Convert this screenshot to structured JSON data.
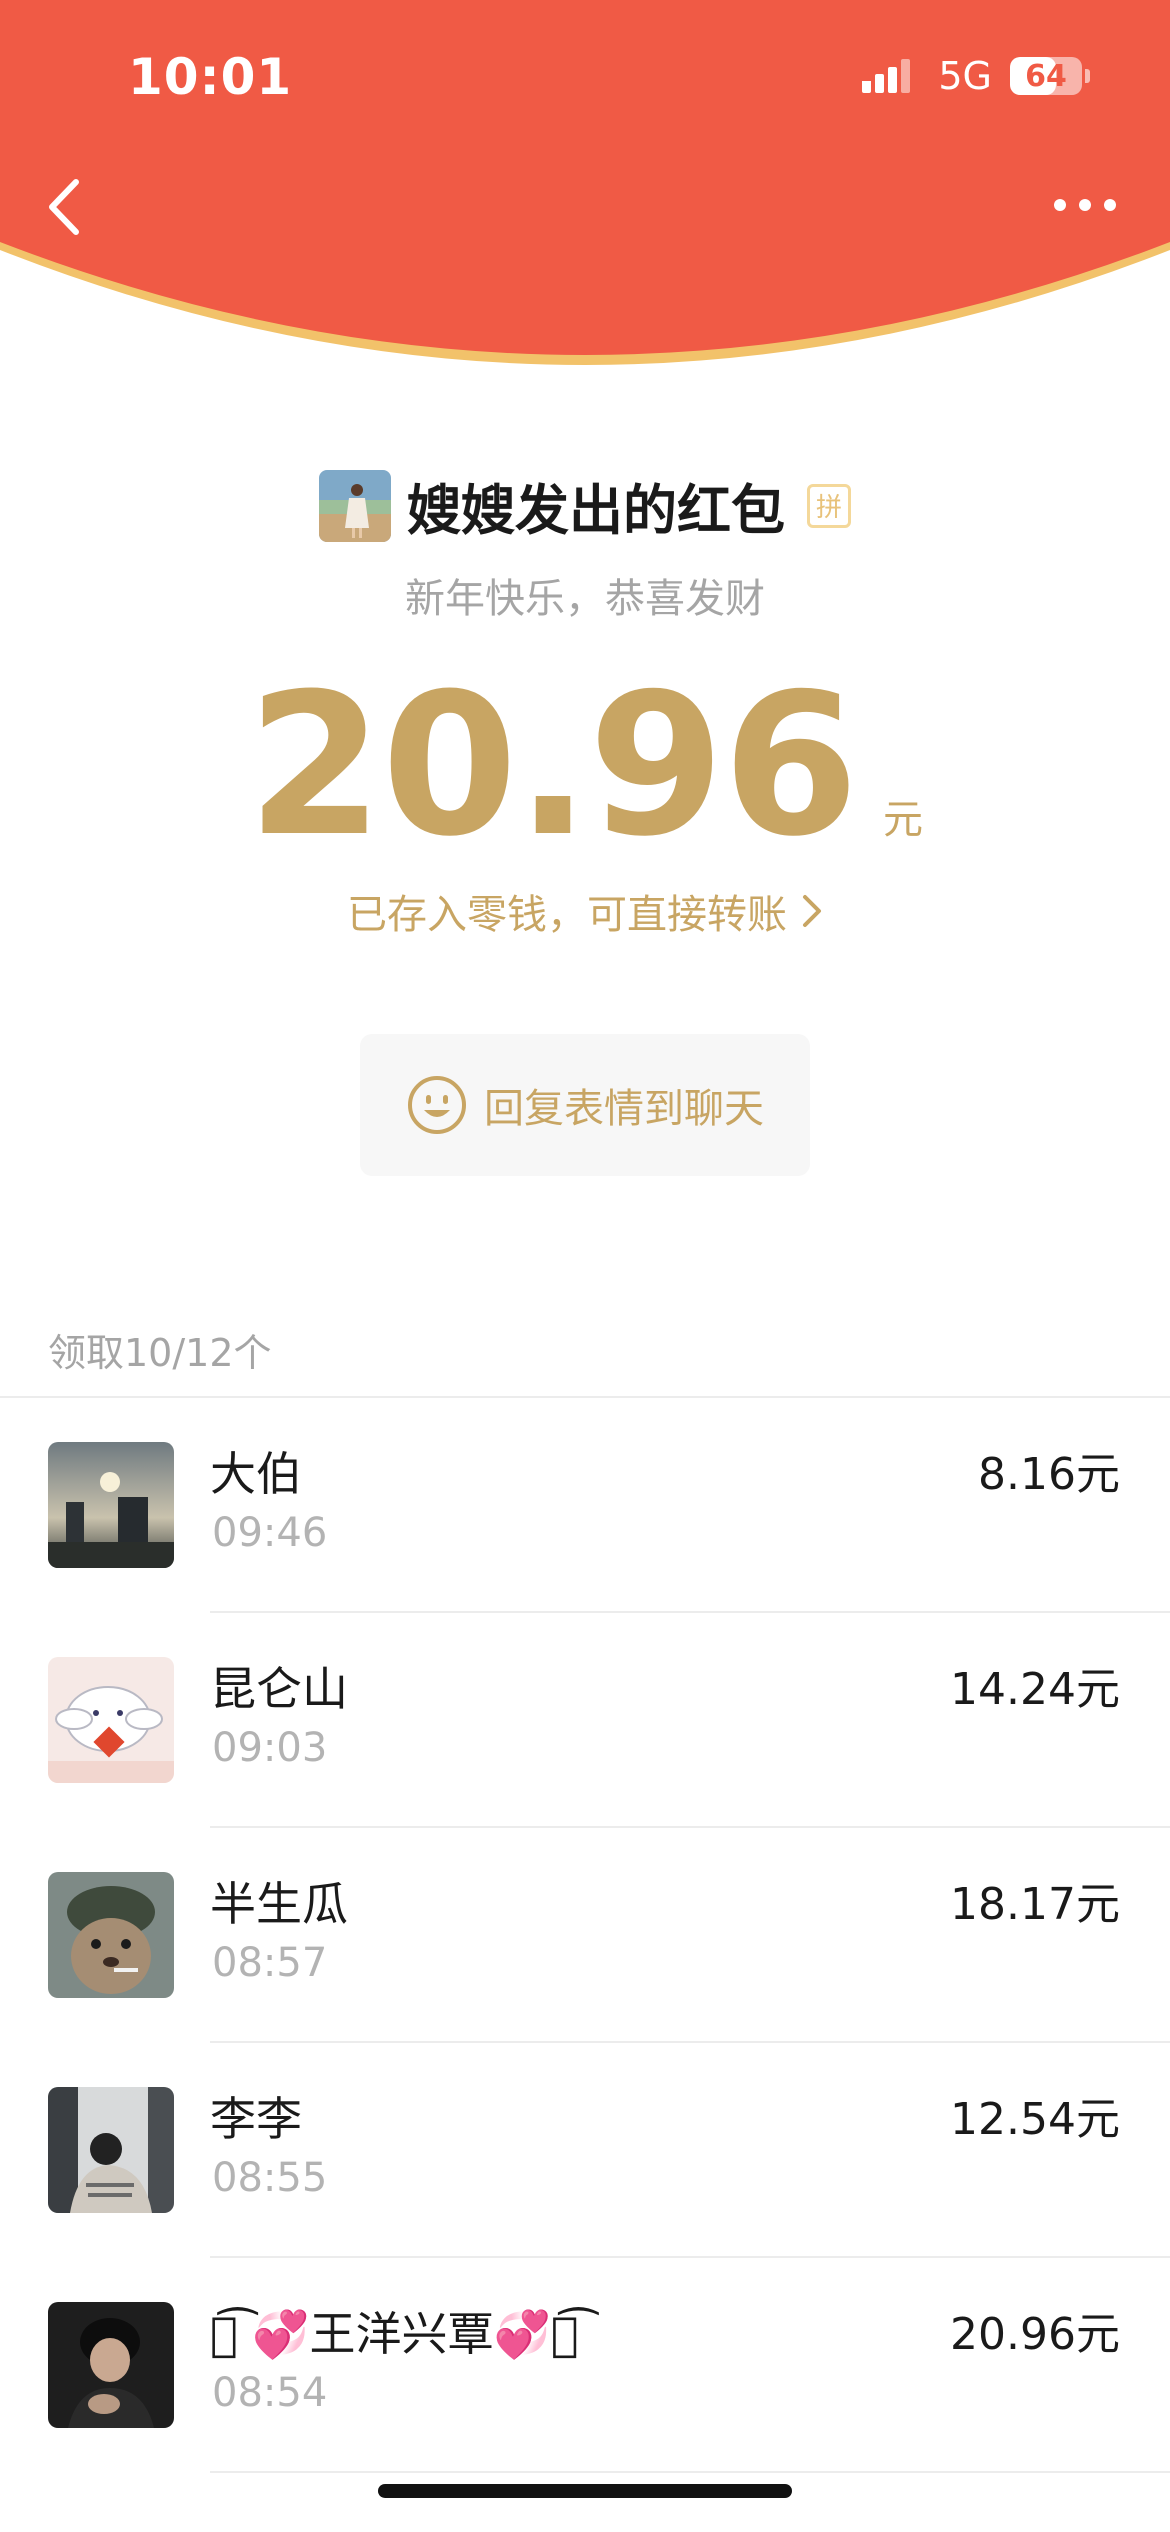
{
  "status_bar": {
    "time": "10:01",
    "network": "5G",
    "battery": "64",
    "battery_level": 0.64
  },
  "nav": {
    "back_icon": "chevron-left-icon",
    "more_icon": "more-dots-icon"
  },
  "colors": {
    "banner_red": "#f05a45",
    "banner_edge": "#f2c26a",
    "gold": "#c8a563"
  },
  "envelope": {
    "sender_title": "嫂嫂发出的红包",
    "pin_badge": "拼",
    "greeting": "新年快乐，恭喜发财",
    "amount": "20.96",
    "unit": "元",
    "saved_text": "已存入零钱，可直接转账",
    "reply_label": "回复表情到聊天"
  },
  "claims": {
    "summary": "领取10/12个",
    "items": [
      {
        "name": "大伯",
        "time": "09:46",
        "amount": "8.16元"
      },
      {
        "name": "昆仑山",
        "time": "09:03",
        "amount": "14.24元"
      },
      {
        "name": "半生瓜",
        "time": "08:57",
        "amount": "18.17元"
      },
      {
        "name": "李李",
        "time": "08:55",
        "amount": "12.54元"
      },
      {
        "name": "ဖ͡ 💞王洋兴覃💞ဖ͡",
        "time": "08:54",
        "amount": "20.96元"
      }
    ]
  }
}
